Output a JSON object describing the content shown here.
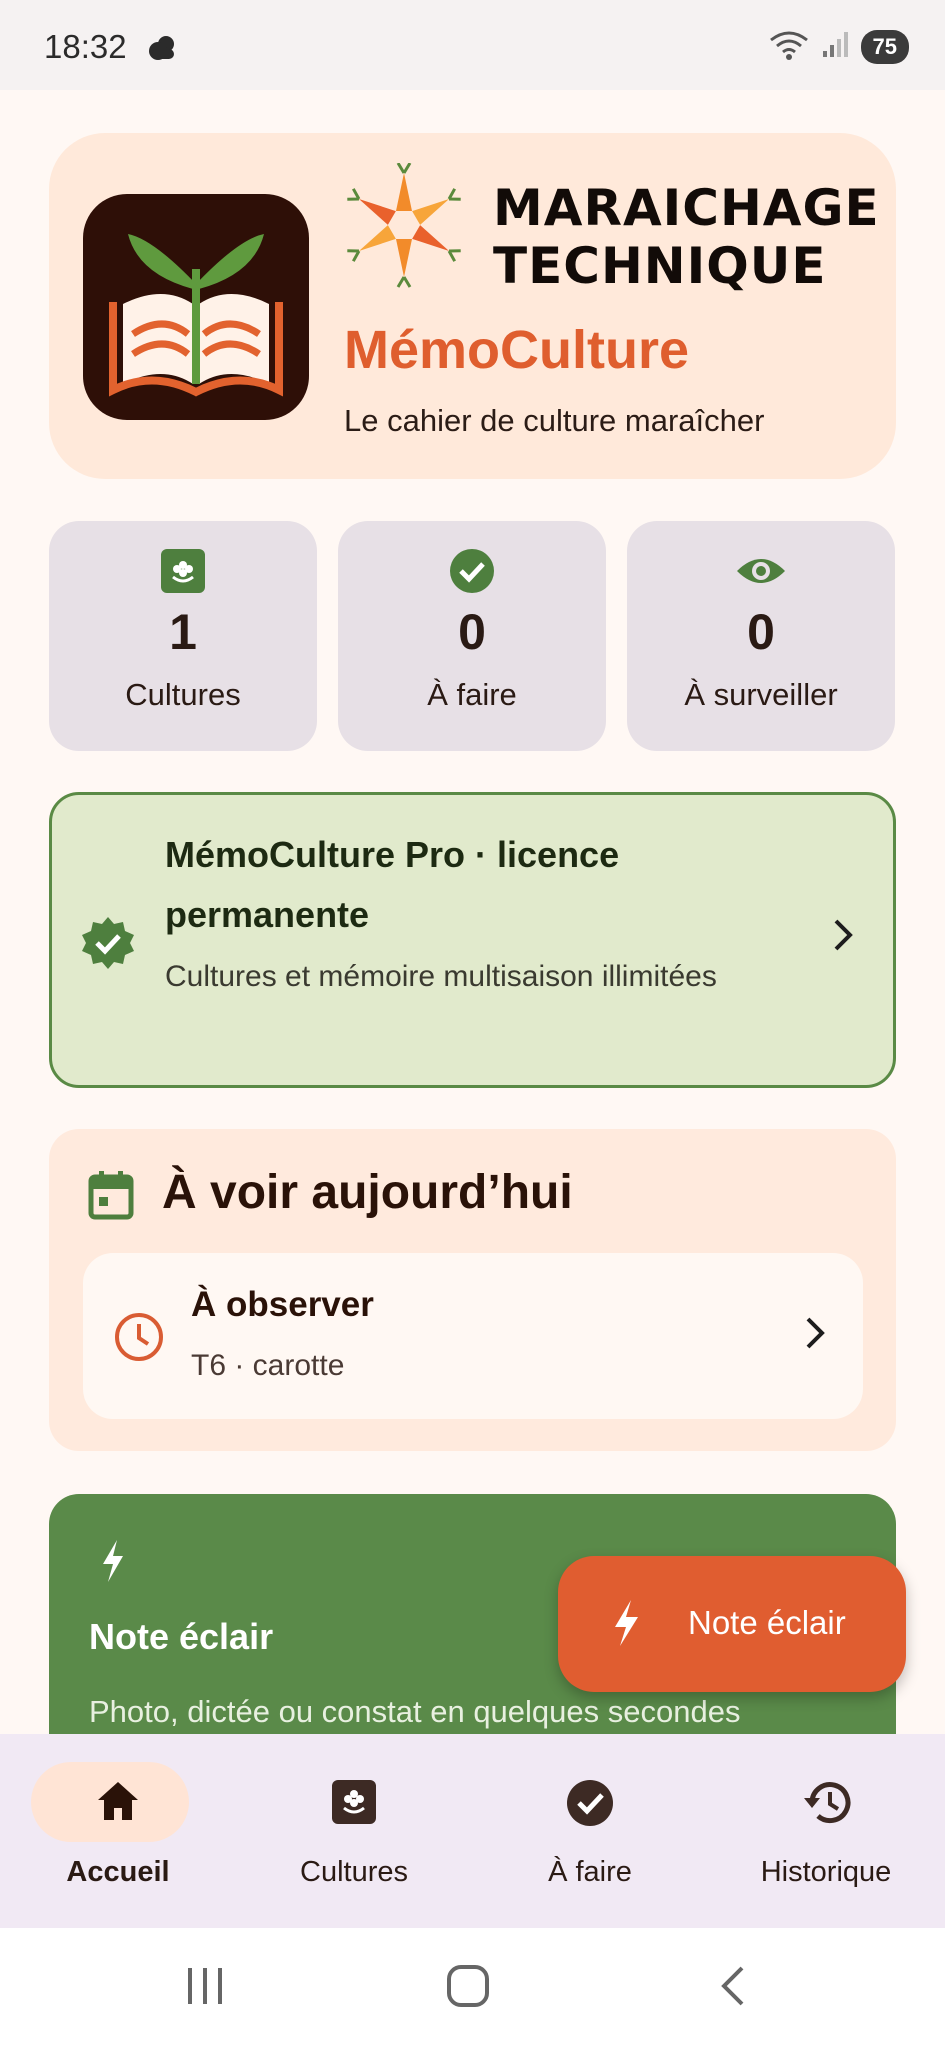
{
  "status_bar": {
    "time": "18:32",
    "battery": "75",
    "weather_icon": "cloud-moon-icon",
    "wifi_icon": "wifi-icon",
    "signal_icon": "signal-icon"
  },
  "header": {
    "brand_line1": "MARAICHAGE",
    "brand_line2": "TECHNIQUE",
    "app_name": "MémoCulture",
    "tagline": "Le cahier de culture maraîcher"
  },
  "stats": [
    {
      "icon": "flower-icon",
      "value": "1",
      "label": "Cultures"
    },
    {
      "icon": "check-circle-icon",
      "value": "0",
      "label": "À faire"
    },
    {
      "icon": "eye-icon",
      "value": "0",
      "label": "À surveiller"
    }
  ],
  "pro": {
    "title": "MémoCulture Pro · licence permanente",
    "description": "Cultures et mémoire multisaison illimitées"
  },
  "today": {
    "title": "À voir aujourd’hui",
    "task_title": "À observer",
    "task_sub": "T6 · carotte"
  },
  "flash": {
    "title": "Note éclair",
    "description": "Photo, dictée ou constat en quelques secondes"
  },
  "fab": {
    "label": "Note éclair"
  },
  "nav": [
    {
      "label": "Accueil",
      "icon": "home-icon",
      "active": true
    },
    {
      "label": "Cultures",
      "icon": "flower-icon",
      "active": false
    },
    {
      "label": "À faire",
      "icon": "check-circle-icon",
      "active": false
    },
    {
      "label": "Historique",
      "icon": "history-icon",
      "active": false
    }
  ],
  "colors": {
    "accent": "#e05d30",
    "green": "#5a8a49",
    "background": "#fff8f4"
  }
}
